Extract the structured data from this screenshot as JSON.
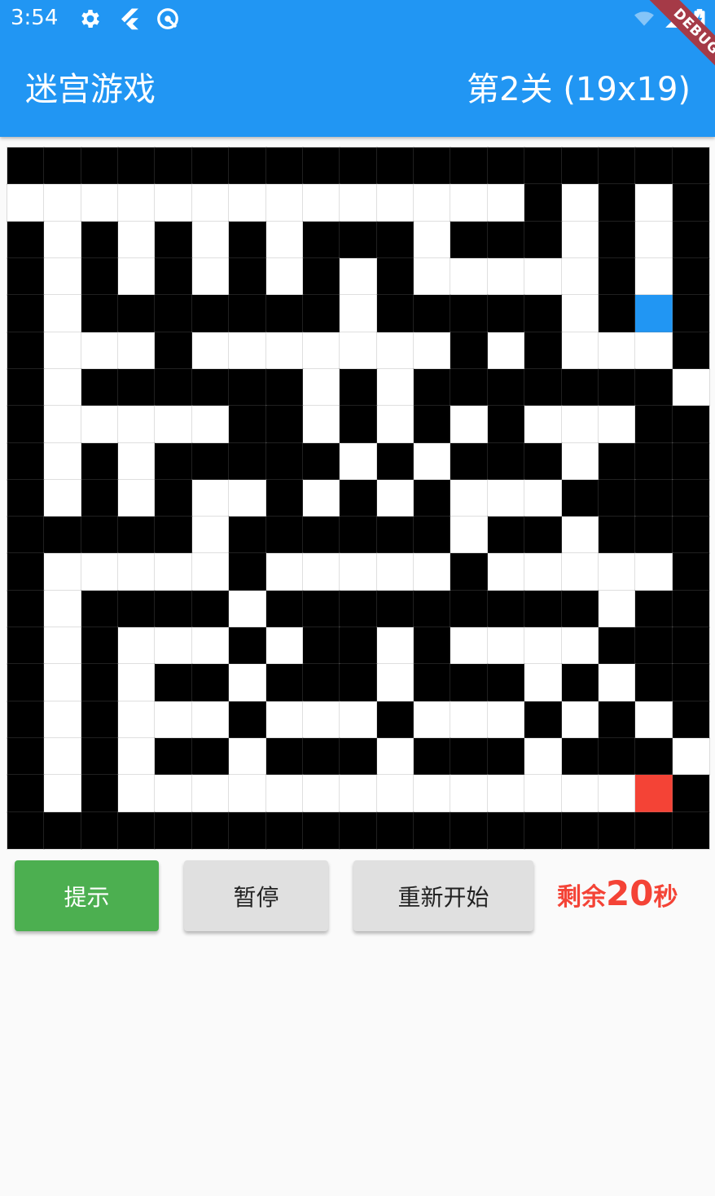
{
  "status_bar": {
    "time": "3:54",
    "icons": [
      "gear-icon",
      "flutter-icon",
      "android-auto-icon",
      "wifi-off-icon",
      "signal-icon",
      "battery-charging-icon"
    ]
  },
  "app_bar": {
    "title": "迷宫游戏",
    "level": "第2关 (19x19)",
    "color": "#2196f3"
  },
  "debug_banner": "DEBUG",
  "maze": {
    "size": 19,
    "legend": {
      "#": "wall",
      ".": "path",
      "P": "player",
      "E": "exit"
    },
    "rows": [
      "###################",
      "..............#.#.#",
      "#.#.#.#.###.###.#.#",
      "#.#.#.#.#.#.....#.#",
      "#.#######.#####.#P###",
      "#...#.......#.#...#",
      "#.######.#.#######.##",
      "#.....##.#.#.#...#",
      "#.#.#####.#.###.###",
      "#.#.#..#.#.#...#",
      "#####.######.##.###",
      "#.....#.....#.....#",
      "#.####.#########.###",
      "#.#...#.##.#....#",
      "#.#.##.###.###.#.###",
      "#.#...#...#...#.#.#",
      "#.#.##.###.###.###.#",
      "#.#..............E",
      "###################"
    ]
  },
  "controls": {
    "hint": "提示",
    "pause": "暂停",
    "restart": "重新开始"
  },
  "timer": {
    "prefix": "剩余",
    "seconds": "20",
    "suffix": "秒",
    "color": "#f44336"
  }
}
